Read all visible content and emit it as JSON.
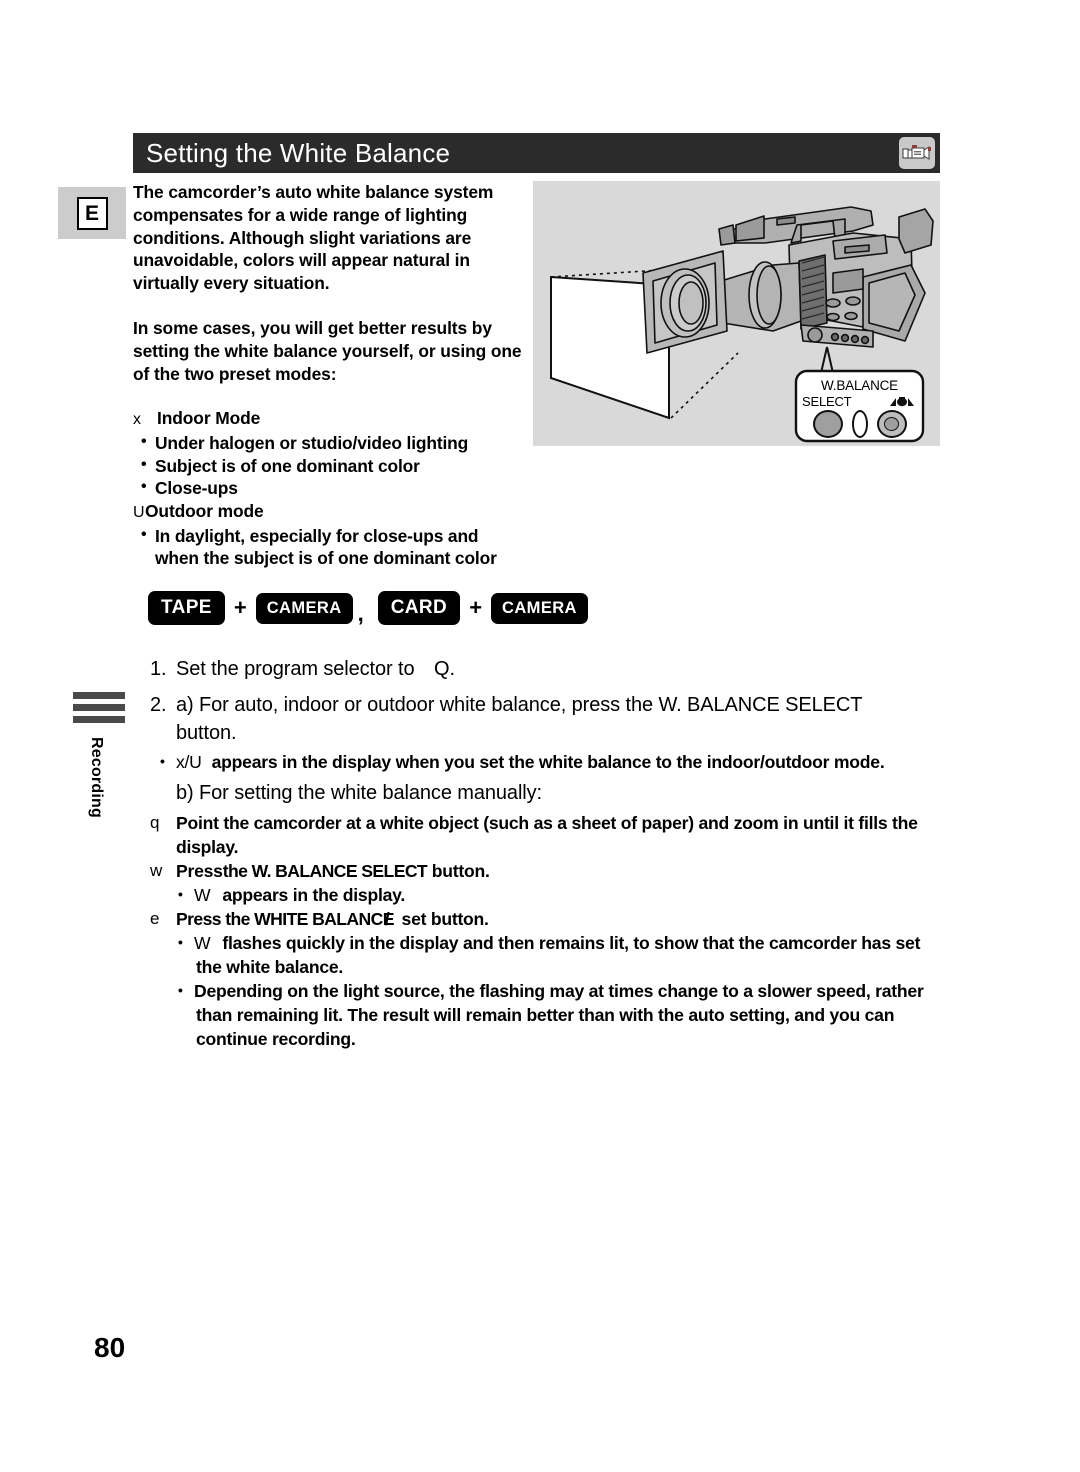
{
  "header": {
    "title": "Setting the White Balance",
    "icon": "camcorder-icon"
  },
  "marker": {
    "letter": "E"
  },
  "intro": {
    "paragraph1": "The camcorder’s auto white balance system compensates for a wide range of lighting conditions. Although slight variations are unavoidable, colors will appear natural in virtually every situation.",
    "paragraph2": "In some cases, you will get better results by setting the white balance yourself, or using one of the two preset modes:"
  },
  "modes": [
    {
      "symbol": "x",
      "name": "Indoor Mode",
      "bullets": [
        "Under halogen or studio/video lighting",
        "Subject is of one dominant color",
        "Close-ups"
      ]
    },
    {
      "symbol": "U",
      "name": "Outdoor mode",
      "bullets": [
        "In daylight, especially for close-ups and",
        "when the subject is of one dominant color"
      ]
    }
  ],
  "badges": {
    "group1": {
      "mode": "TAPE",
      "plus": "+",
      "sub": "CAMERA"
    },
    "separator": ",",
    "group2": {
      "mode": "CARD",
      "plus": "+",
      "sub": "CAMERA"
    }
  },
  "side_tab": {
    "label": "Recording"
  },
  "steps": [
    {
      "num": "1.",
      "text_before": "Set the program selector to",
      "glyph": "Q",
      "text_after": "."
    },
    {
      "num": "2.",
      "text": "a) For auto, indoor or outdoor white balance, press the W. BALANCE SELECT",
      "continuation": "button."
    }
  ],
  "notes": {
    "note_2a_glyph": "x/U",
    "note_2a": "appears in the display when you set the white balance to the indoor/outdoor mode.",
    "step_2b": "b) For setting the white balance manually:",
    "sub_q_glyph": "q",
    "sub_q": "Point the camcorder at a white object (such as a sheet of paper) and zoom in until it fills the",
    "sub_q_cont": "display.",
    "sub_w_glyph": "w",
    "sub_w_a": "Press",
    "sub_w_b": "the W. BALANCE SELECT",
    "sub_w_c": "button.",
    "note_w_glyph": "W",
    "note_w": "appears in the display.",
    "sub_e_glyph": "e",
    "sub_e_a": "Press the WHITE BALANCE",
    "sub_e_b": "/",
    "sub_e_c": "set button.",
    "note_e_glyph": "W",
    "note_e": "flashes quickly in the display and then remains lit, to show that the camcorder has set",
    "note_e_cont": "the white balance.",
    "note_final": "Depending on the light source, the flashing may at times change to a slower speed, rather",
    "note_final_2": "than remaining lit. The result will remain better than with the auto setting, and you can",
    "note_final_3": "continue recording."
  },
  "illustration": {
    "callout_title": "W.BALANCE",
    "callout_select": "SELECT",
    "callout_set_icon": "white-balance-set-icon",
    "subject": "white-paper-sheet",
    "device": "camcorder-illustration"
  },
  "page": {
    "number": "80"
  }
}
